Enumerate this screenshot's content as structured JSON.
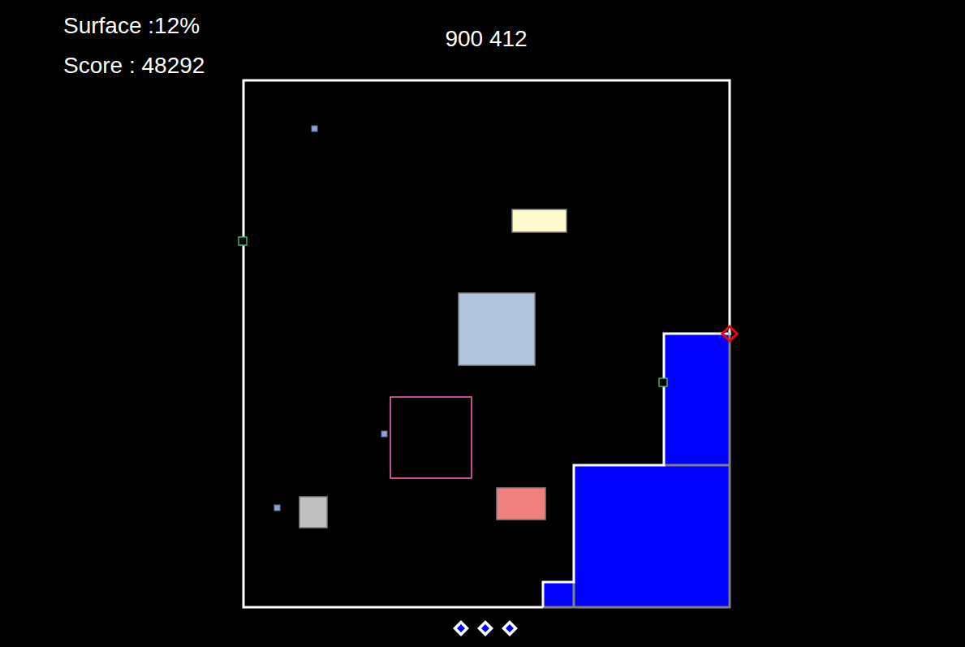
{
  "hud": {
    "surface": "Surface :12%",
    "score": "Score : 48292",
    "coords": "900 412"
  },
  "lives": 3,
  "obstacles": [
    {
      "color": "#fffacd",
      "outline": false
    },
    {
      "color": "#b0c4de",
      "outline": false
    },
    {
      "color": "#ff69b4",
      "outline": true
    },
    {
      "color": "#f08080",
      "outline": false
    },
    {
      "color": "#c0c0c0",
      "outline": false
    }
  ],
  "balls": [
    {
      "color": "#8fa3d0"
    },
    {
      "color": "#8fa3d0"
    },
    {
      "color": "#8fa3d0"
    }
  ],
  "sparks": [
    {
      "color": "#3cb371"
    },
    {
      "color": "#3cb371"
    }
  ],
  "player": {
    "color": "#ff0000"
  },
  "captured": {
    "color": "#0000ff"
  }
}
